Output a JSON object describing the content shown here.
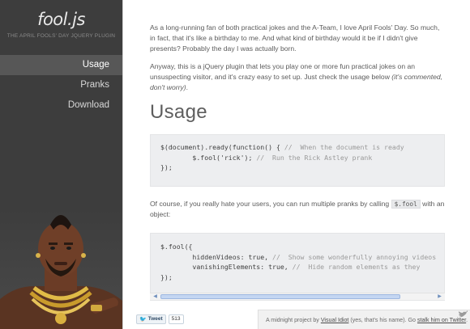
{
  "brand": {
    "logo": "fool.js",
    "tagline": "THE APRIL FOOLS' DAY JQUERY PLUGIN"
  },
  "nav": {
    "items": [
      {
        "label": "Usage",
        "active": true
      },
      {
        "label": "Pranks",
        "active": false
      },
      {
        "label": "Download",
        "active": false
      }
    ]
  },
  "intro": {
    "p1": "As a long-running fan of both practical jokes and the A-Team, I love April Fools' Day. So much, in fact, that it's like a birthday to me. And what kind of birthday would it be if I didn't give presents? Probably the day I was actually born.",
    "p2_text": "Anyway, this is a jQuery plugin that lets you play one or more fun practical jokes on an unsuspecting visitor, and it's crazy easy to set up. Just check the usage below ",
    "p2_em": "(it's commented, don't worry)",
    "p2_end": "."
  },
  "usage": {
    "title": "Usage",
    "code1": {
      "line1_code": "$(document).ready(function() { ",
      "line1_comment": "//  When the document is ready",
      "line2_code": "        $.fool('rick'); ",
      "line2_comment": "//  Run the Rick Astley prank",
      "line3_code": "});"
    },
    "para2_before": "Of course, if you really hate your users, you can run multiple pranks by calling ",
    "para2_code": "$.fool",
    "para2_after": " with an object:",
    "code2": {
      "line1_code": "$.fool({",
      "line2_code": "        hiddenVideos: true, ",
      "line2_comment": "//  Show some wonderfully annoying videos",
      "line3_code": "        vanishingElements: true, ",
      "line3_comment": "//  Hide random elements as they",
      "line4_code": "});"
    }
  },
  "tweet": {
    "label": "Tweet",
    "count": "513"
  },
  "footer": {
    "text_before": "A midnight project by ",
    "author_link": "Visual Idiot",
    "text_middle": " (yes, that's his name). Go ",
    "twitter_link": "stalk him on Twitter",
    "text_after": "."
  },
  "colors": {
    "sidebar_bg": "#3d3d3d",
    "nav_active_bg": "#575757",
    "code_bg": "#edeef0",
    "text": "#5b5b5b"
  },
  "icons": {
    "tweet_bird": "twitter-bird-icon",
    "corner": "twitter-bird-icon"
  }
}
